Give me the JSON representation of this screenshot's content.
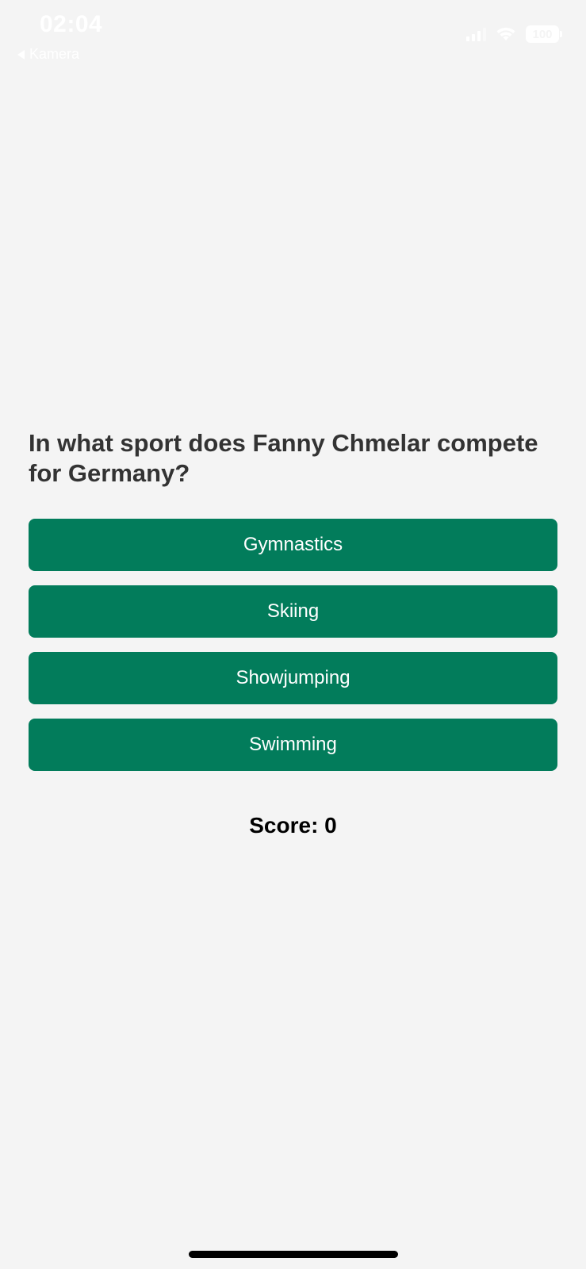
{
  "status_bar": {
    "time": "02:04",
    "back_label": "Kamera",
    "battery": "100",
    "signal_icon": "cellular-signal-icon",
    "wifi_icon": "wifi-icon",
    "battery_icon": "battery-icon"
  },
  "quiz": {
    "question": "In what sport does Fanny Chmelar compete for Germany?",
    "answers": [
      "Gymnastics",
      "Skiing",
      "Showjumping",
      "Swimming"
    ],
    "score_text": "Score: 0"
  },
  "colors": {
    "background": "#f4f4f4",
    "answer_button": "#027c5b",
    "question_text": "#333333"
  }
}
